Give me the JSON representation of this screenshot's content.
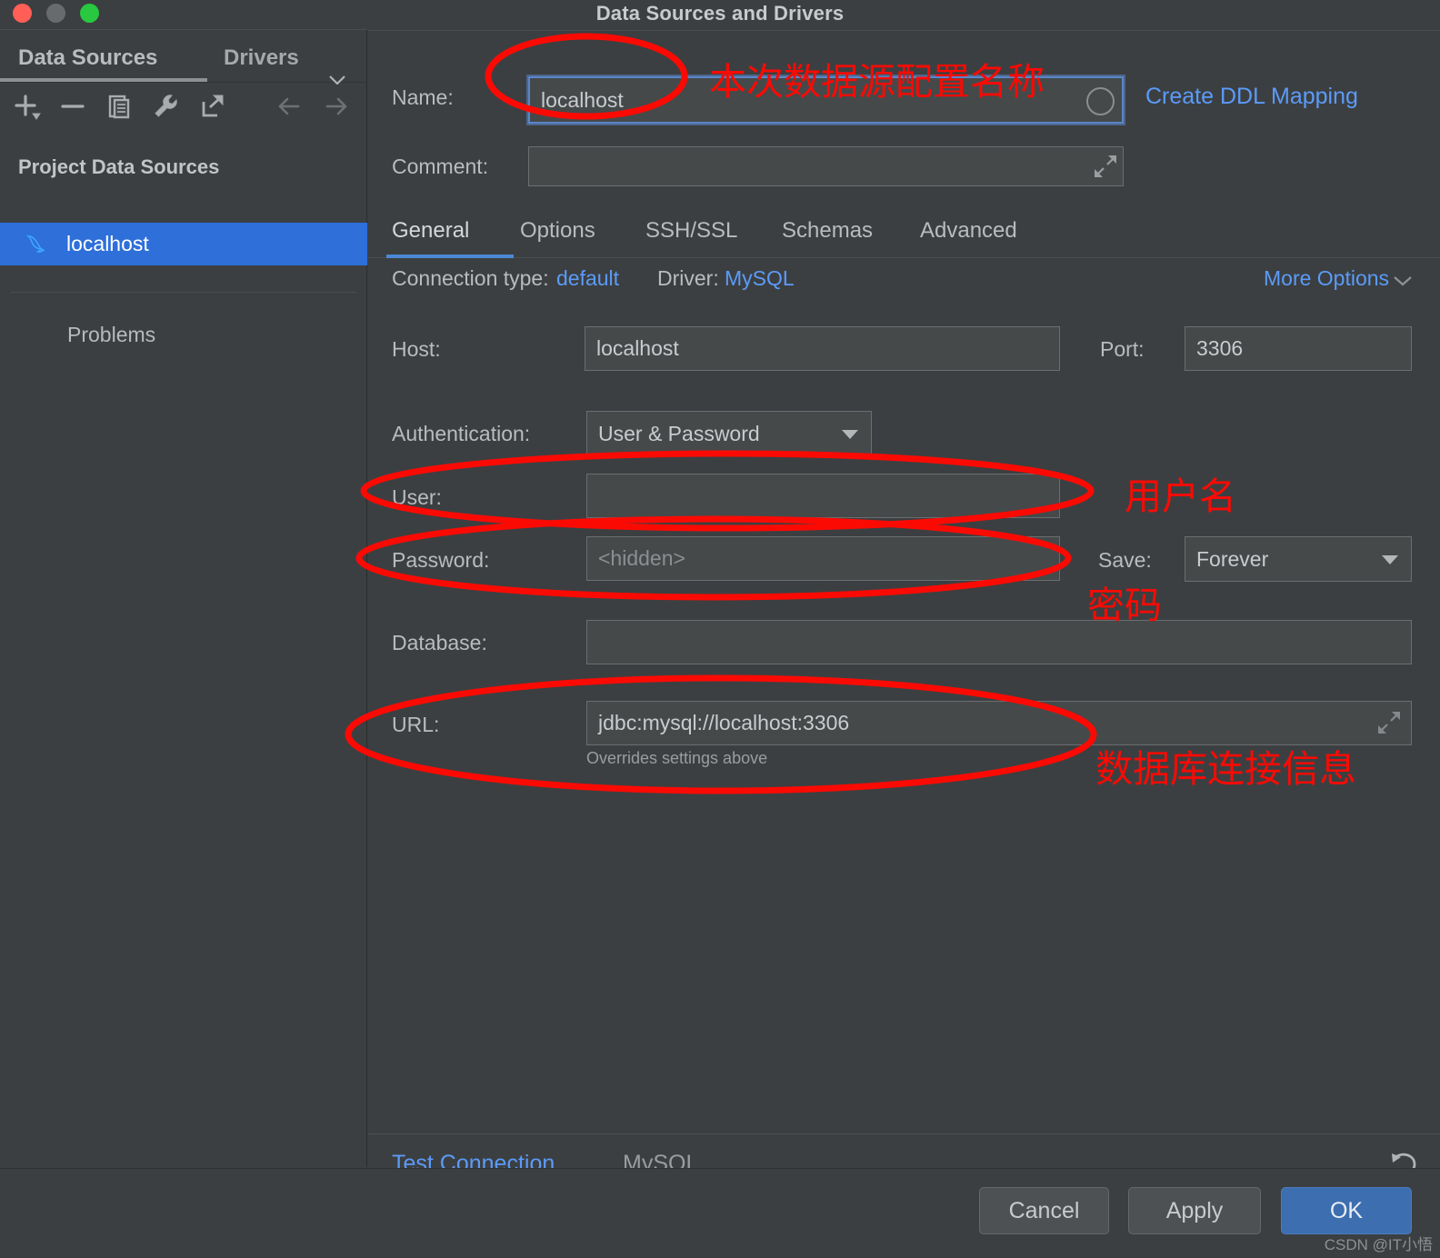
{
  "window": {
    "title": "Data Sources and Drivers",
    "traffic_lights": [
      "close-red",
      "minimize-yellow",
      "maximize-green"
    ]
  },
  "sidebar": {
    "tabs": [
      {
        "label": "Data Sources",
        "active": true
      },
      {
        "label": "Drivers",
        "active": false
      }
    ],
    "chevron_icon": "chevron-down-icon",
    "toolbar_icons": [
      "add-icon",
      "remove-icon",
      "copy-icon",
      "properties-wrench-icon",
      "jump-to-editor-icon",
      "back-arrow-icon",
      "forward-arrow-icon"
    ],
    "section_title": "Project Data Sources",
    "items": [
      {
        "label": "localhost",
        "icon": "mysql-dolphin-icon",
        "selected": true
      }
    ],
    "problems_label": "Problems",
    "help_label": "?"
  },
  "form": {
    "name_label": "Name:",
    "name_value": "localhost",
    "comment_label": "Comment:",
    "comment_value": "",
    "create_ddl_mapping": "Create DDL Mapping",
    "expand_icon": "expand-diagonal-icon",
    "progress_icon": "progress-circle-icon"
  },
  "tabs": [
    {
      "label": "General",
      "active": true
    },
    {
      "label": "Options",
      "active": false
    },
    {
      "label": "SSH/SSL",
      "active": false
    },
    {
      "label": "Schemas",
      "active": false
    },
    {
      "label": "Advanced",
      "active": false
    }
  ],
  "connection": {
    "connection_type_label": "Connection type:",
    "connection_type_value": "default",
    "driver_label": "Driver:",
    "driver_value": "MySQL",
    "more_options": "More Options",
    "more_options_icon": "chevron-down-icon",
    "host_label": "Host:",
    "host_value": "localhost",
    "port_label": "Port:",
    "port_value": "3306",
    "authentication_label": "Authentication:",
    "authentication_value": "User & Password",
    "user_label": "User:",
    "user_value": "",
    "password_label": "Password:",
    "password_placeholder": "<hidden>",
    "save_label": "Save:",
    "save_value": "Forever",
    "database_label": "Database:",
    "database_value": "",
    "url_label": "URL:",
    "url_value": "jdbc:mysql://localhost:3306",
    "url_hint": "Overrides settings above"
  },
  "footer": {
    "test_connection": "Test Connection",
    "driver_name": "MySQL",
    "revert_icon": "revert-arrow-icon",
    "buttons": [
      {
        "label": "Cancel",
        "style": "plain"
      },
      {
        "label": "Apply",
        "style": "plain"
      },
      {
        "label": "OK",
        "style": "primary"
      }
    ]
  },
  "annotations": {
    "color": "#fb0a04",
    "items": [
      {
        "text": "本次数据源配置名称",
        "shape": "ellipse-around-name-field"
      },
      {
        "text": "用户名",
        "shape": "ellipse-around-user-field"
      },
      {
        "text": "密码",
        "shape": "ellipse-around-password-field"
      },
      {
        "text": "数据库连接信息",
        "shape": "ellipse-around-url-field"
      }
    ]
  },
  "watermark": "CSDN @IT小悟",
  "colors": {
    "window_bg": "#3c3f41",
    "field_bg": "#45494a",
    "accent_blue": "#2e6fd9",
    "link_blue": "#5b9bf8",
    "tab_underline": "#4a88d4",
    "primary_button": "#3c6eb0",
    "annotation_red": "#fb0a04"
  }
}
